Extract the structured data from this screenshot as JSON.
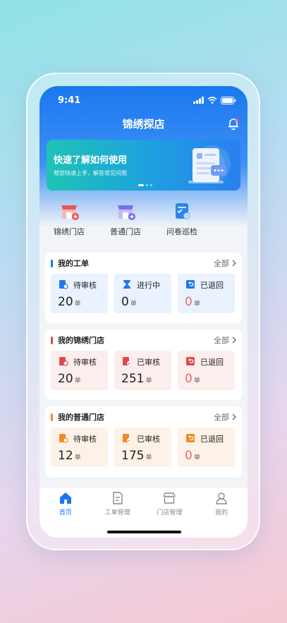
{
  "status_bar": {
    "time": "9:41"
  },
  "header": {
    "title": "锦绣探店"
  },
  "banner": {
    "title": "快速了解如何使用",
    "subtitle": "帮您快速上手，解答常见问题"
  },
  "quick_actions": [
    {
      "label": "锦绣门店",
      "icon": "store-add-icon",
      "color": "#e8565a"
    },
    {
      "label": "普通门店",
      "icon": "store-add-icon",
      "color": "#7d6cf0"
    },
    {
      "label": "问卷巡检",
      "icon": "survey-icon",
      "color": "#2a84ef"
    }
  ],
  "cards": [
    {
      "title": "我的工单",
      "more": "全部",
      "accent": "#1a78ef",
      "tiles": [
        {
          "label": "待审核",
          "value": "20",
          "unit": "单",
          "icon": "document-search-icon"
        },
        {
          "label": "进行中",
          "value": "0",
          "unit": "单",
          "icon": "hourglass-icon"
        },
        {
          "label": "已退回",
          "value": "0",
          "unit": "单",
          "icon": "return-icon"
        }
      ]
    },
    {
      "title": "我的锦绣门店",
      "more": "全部",
      "accent": "#e0474c",
      "tiles": [
        {
          "label": "待审核",
          "value": "20",
          "unit": "单",
          "icon": "document-search-icon"
        },
        {
          "label": "已审核",
          "value": "251",
          "unit": "单",
          "icon": "document-check-icon"
        },
        {
          "label": "已退回",
          "value": "0",
          "unit": "单",
          "icon": "return-icon"
        }
      ]
    },
    {
      "title": "我的普通门店",
      "more": "全部",
      "accent": "#f08a24",
      "tiles": [
        {
          "label": "待审核",
          "value": "12",
          "unit": "单",
          "icon": "document-search-icon"
        },
        {
          "label": "已审核",
          "value": "175",
          "unit": "单",
          "icon": "document-check-icon"
        },
        {
          "label": "已退回",
          "value": "0",
          "unit": "单",
          "icon": "return-icon"
        }
      ]
    }
  ],
  "tabbar": [
    {
      "label": "首页",
      "icon": "home-icon",
      "active": true
    },
    {
      "label": "工单管理",
      "icon": "document-icon",
      "active": false
    },
    {
      "label": "门店管理",
      "icon": "store-icon",
      "active": false
    },
    {
      "label": "我的",
      "icon": "user-icon",
      "active": false
    }
  ]
}
